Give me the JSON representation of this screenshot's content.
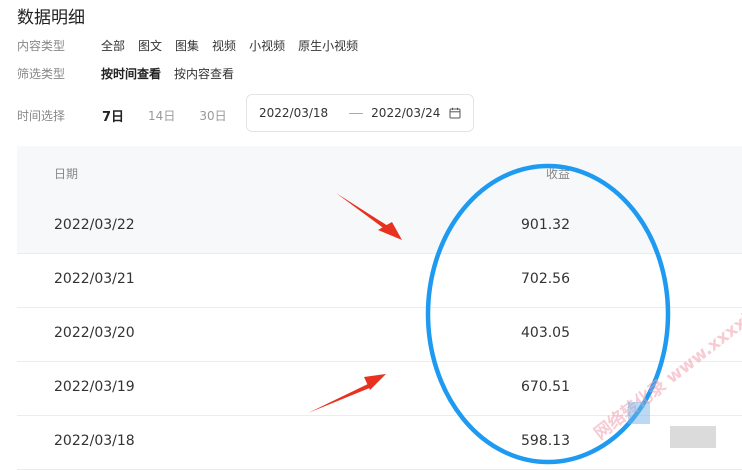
{
  "page_title": "数据明细",
  "content_type": {
    "label": "内容类型",
    "options": [
      "全部",
      "图文",
      "图集",
      "视频",
      "小视频",
      "原生小视频"
    ]
  },
  "filter_type": {
    "label": "筛选类型",
    "options": [
      "按时间查看",
      "按内容查看"
    ]
  },
  "time_select": {
    "label": "时间选择",
    "options": [
      "7日",
      "14日",
      "30日"
    ],
    "selected": "7日",
    "start_date": "2022/03/18",
    "end_date": "2022/03/24"
  },
  "table": {
    "headers": {
      "date": "日期",
      "income": "收益"
    },
    "rows": [
      {
        "date": "2022/03/22",
        "income": "901.32"
      },
      {
        "date": "2022/03/21",
        "income": "702.56"
      },
      {
        "date": "2022/03/20",
        "income": "403.05"
      },
      {
        "date": "2022/03/19",
        "income": "670.51"
      },
      {
        "date": "2022/03/18",
        "income": "598.13"
      }
    ]
  },
  "watermark": "网络转化录 www.xxxxling.com",
  "colors": {
    "annotation_circle": "#1e9bf0",
    "annotation_arrow": "#e8311f",
    "header_bg": "#f7f8fa",
    "label_gray": "#888888"
  }
}
